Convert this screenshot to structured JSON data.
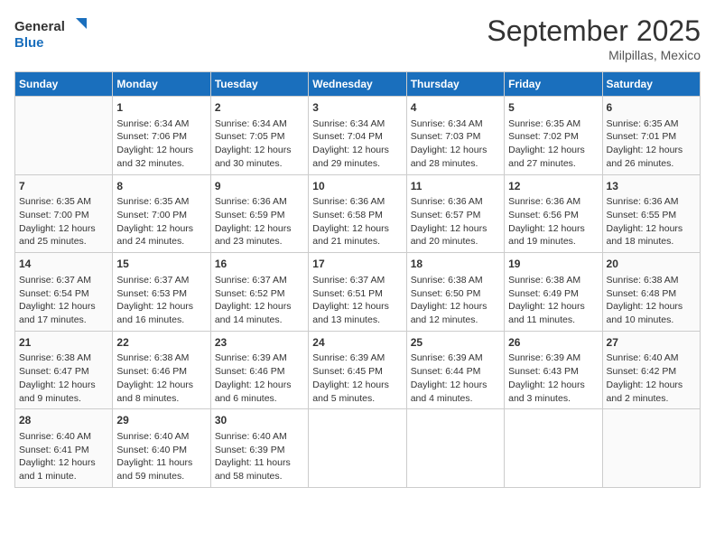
{
  "header": {
    "logo_line1": "General",
    "logo_line2": "Blue",
    "month_title": "September 2025",
    "location": "Milpillas, Mexico"
  },
  "days_of_week": [
    "Sunday",
    "Monday",
    "Tuesday",
    "Wednesday",
    "Thursday",
    "Friday",
    "Saturday"
  ],
  "weeks": [
    [
      {
        "day": "",
        "content": ""
      },
      {
        "day": "1",
        "content": "Sunrise: 6:34 AM\nSunset: 7:06 PM\nDaylight: 12 hours and 32 minutes."
      },
      {
        "day": "2",
        "content": "Sunrise: 6:34 AM\nSunset: 7:05 PM\nDaylight: 12 hours and 30 minutes."
      },
      {
        "day": "3",
        "content": "Sunrise: 6:34 AM\nSunset: 7:04 PM\nDaylight: 12 hours and 29 minutes."
      },
      {
        "day": "4",
        "content": "Sunrise: 6:34 AM\nSunset: 7:03 PM\nDaylight: 12 hours and 28 minutes."
      },
      {
        "day": "5",
        "content": "Sunrise: 6:35 AM\nSunset: 7:02 PM\nDaylight: 12 hours and 27 minutes."
      },
      {
        "day": "6",
        "content": "Sunrise: 6:35 AM\nSunset: 7:01 PM\nDaylight: 12 hours and 26 minutes."
      }
    ],
    [
      {
        "day": "7",
        "content": "Sunrise: 6:35 AM\nSunset: 7:00 PM\nDaylight: 12 hours and 25 minutes."
      },
      {
        "day": "8",
        "content": "Sunrise: 6:35 AM\nSunset: 7:00 PM\nDaylight: 12 hours and 24 minutes."
      },
      {
        "day": "9",
        "content": "Sunrise: 6:36 AM\nSunset: 6:59 PM\nDaylight: 12 hours and 23 minutes."
      },
      {
        "day": "10",
        "content": "Sunrise: 6:36 AM\nSunset: 6:58 PM\nDaylight: 12 hours and 21 minutes."
      },
      {
        "day": "11",
        "content": "Sunrise: 6:36 AM\nSunset: 6:57 PM\nDaylight: 12 hours and 20 minutes."
      },
      {
        "day": "12",
        "content": "Sunrise: 6:36 AM\nSunset: 6:56 PM\nDaylight: 12 hours and 19 minutes."
      },
      {
        "day": "13",
        "content": "Sunrise: 6:36 AM\nSunset: 6:55 PM\nDaylight: 12 hours and 18 minutes."
      }
    ],
    [
      {
        "day": "14",
        "content": "Sunrise: 6:37 AM\nSunset: 6:54 PM\nDaylight: 12 hours and 17 minutes."
      },
      {
        "day": "15",
        "content": "Sunrise: 6:37 AM\nSunset: 6:53 PM\nDaylight: 12 hours and 16 minutes."
      },
      {
        "day": "16",
        "content": "Sunrise: 6:37 AM\nSunset: 6:52 PM\nDaylight: 12 hours and 14 minutes."
      },
      {
        "day": "17",
        "content": "Sunrise: 6:37 AM\nSunset: 6:51 PM\nDaylight: 12 hours and 13 minutes."
      },
      {
        "day": "18",
        "content": "Sunrise: 6:38 AM\nSunset: 6:50 PM\nDaylight: 12 hours and 12 minutes."
      },
      {
        "day": "19",
        "content": "Sunrise: 6:38 AM\nSunset: 6:49 PM\nDaylight: 12 hours and 11 minutes."
      },
      {
        "day": "20",
        "content": "Sunrise: 6:38 AM\nSunset: 6:48 PM\nDaylight: 12 hours and 10 minutes."
      }
    ],
    [
      {
        "day": "21",
        "content": "Sunrise: 6:38 AM\nSunset: 6:47 PM\nDaylight: 12 hours and 9 minutes."
      },
      {
        "day": "22",
        "content": "Sunrise: 6:38 AM\nSunset: 6:46 PM\nDaylight: 12 hours and 8 minutes."
      },
      {
        "day": "23",
        "content": "Sunrise: 6:39 AM\nSunset: 6:46 PM\nDaylight: 12 hours and 6 minutes."
      },
      {
        "day": "24",
        "content": "Sunrise: 6:39 AM\nSunset: 6:45 PM\nDaylight: 12 hours and 5 minutes."
      },
      {
        "day": "25",
        "content": "Sunrise: 6:39 AM\nSunset: 6:44 PM\nDaylight: 12 hours and 4 minutes."
      },
      {
        "day": "26",
        "content": "Sunrise: 6:39 AM\nSunset: 6:43 PM\nDaylight: 12 hours and 3 minutes."
      },
      {
        "day": "27",
        "content": "Sunrise: 6:40 AM\nSunset: 6:42 PM\nDaylight: 12 hours and 2 minutes."
      }
    ],
    [
      {
        "day": "28",
        "content": "Sunrise: 6:40 AM\nSunset: 6:41 PM\nDaylight: 12 hours and 1 minute."
      },
      {
        "day": "29",
        "content": "Sunrise: 6:40 AM\nSunset: 6:40 PM\nDaylight: 11 hours and 59 minutes."
      },
      {
        "day": "30",
        "content": "Sunrise: 6:40 AM\nSunset: 6:39 PM\nDaylight: 11 hours and 58 minutes."
      },
      {
        "day": "",
        "content": ""
      },
      {
        "day": "",
        "content": ""
      },
      {
        "day": "",
        "content": ""
      },
      {
        "day": "",
        "content": ""
      }
    ]
  ]
}
